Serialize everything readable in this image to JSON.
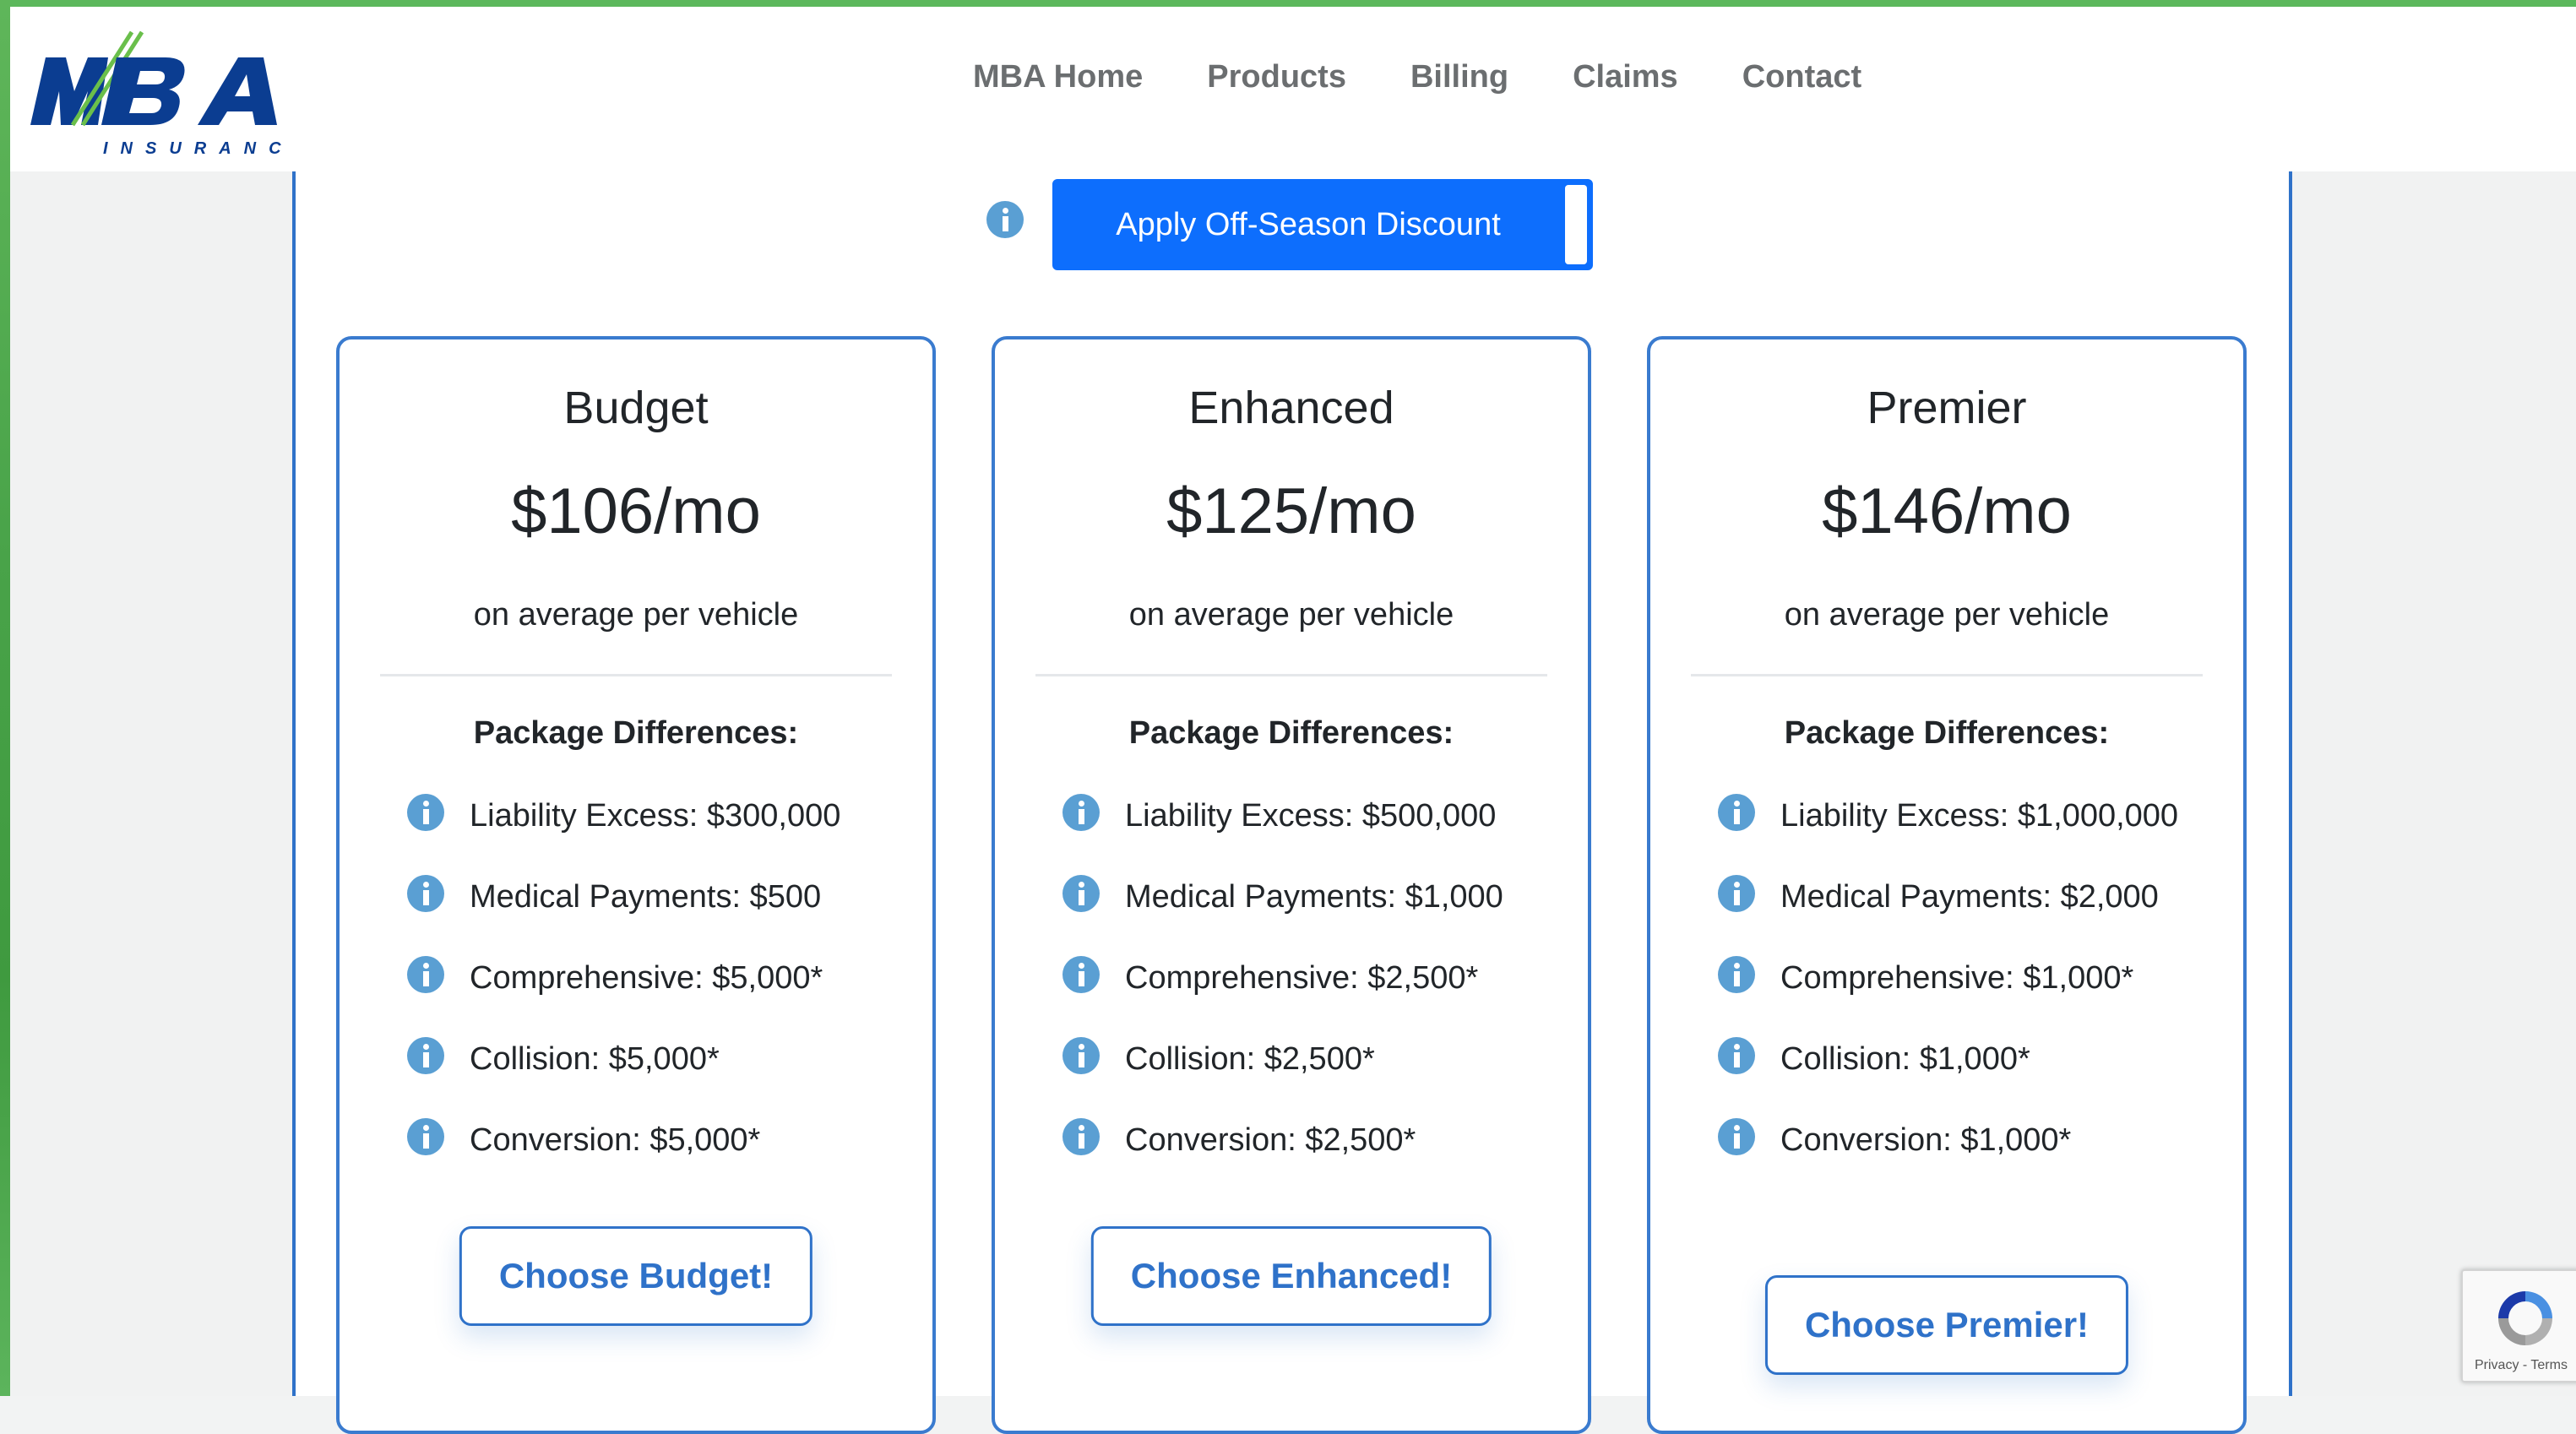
{
  "header": {
    "logo_text": "MBA",
    "logo_subtext": "INSURANCE",
    "nav": [
      {
        "label": "MBA Home"
      },
      {
        "label": "Products"
      },
      {
        "label": "Billing"
      },
      {
        "label": "Claims"
      },
      {
        "label": "Contact"
      }
    ]
  },
  "discount": {
    "label": "Apply Off-Season Discount",
    "icon": "info-icon"
  },
  "common": {
    "per_vehicle": "on average per vehicle",
    "differences_title": "Package Differences:"
  },
  "plans": [
    {
      "name": "Budget",
      "price": "$106/mo",
      "features": [
        "Liability Excess: $300,000",
        "Medical Payments: $500",
        "Comprehensive: $5,000*",
        "Collision: $5,000*",
        "Conversion: $5,000*"
      ],
      "button": "Choose Budget!"
    },
    {
      "name": "Enhanced",
      "price": "$125/mo",
      "features": [
        "Liability Excess: $500,000",
        "Medical Payments: $1,000",
        "Comprehensive: $2,500*",
        "Collision: $2,500*",
        "Conversion: $2,500*"
      ],
      "button": "Choose Enhanced!"
    },
    {
      "name": "Premier",
      "price": "$146/mo",
      "features": [
        "Liability Excess: $1,000,000",
        "Medical Payments: $2,000",
        "Comprehensive: $1,000*",
        "Collision: $1,000*",
        "Conversion: $1,000*"
      ],
      "button": "Choose Premier!"
    }
  ],
  "recaptcha": {
    "text": "Privacy - Terms"
  },
  "colors": {
    "accent": "#2f72c9",
    "primary_button": "#0d6efd",
    "info_icon": "#5a9fd3",
    "logo_blue": "#0b3d91",
    "logo_green": "#6abf4b"
  }
}
